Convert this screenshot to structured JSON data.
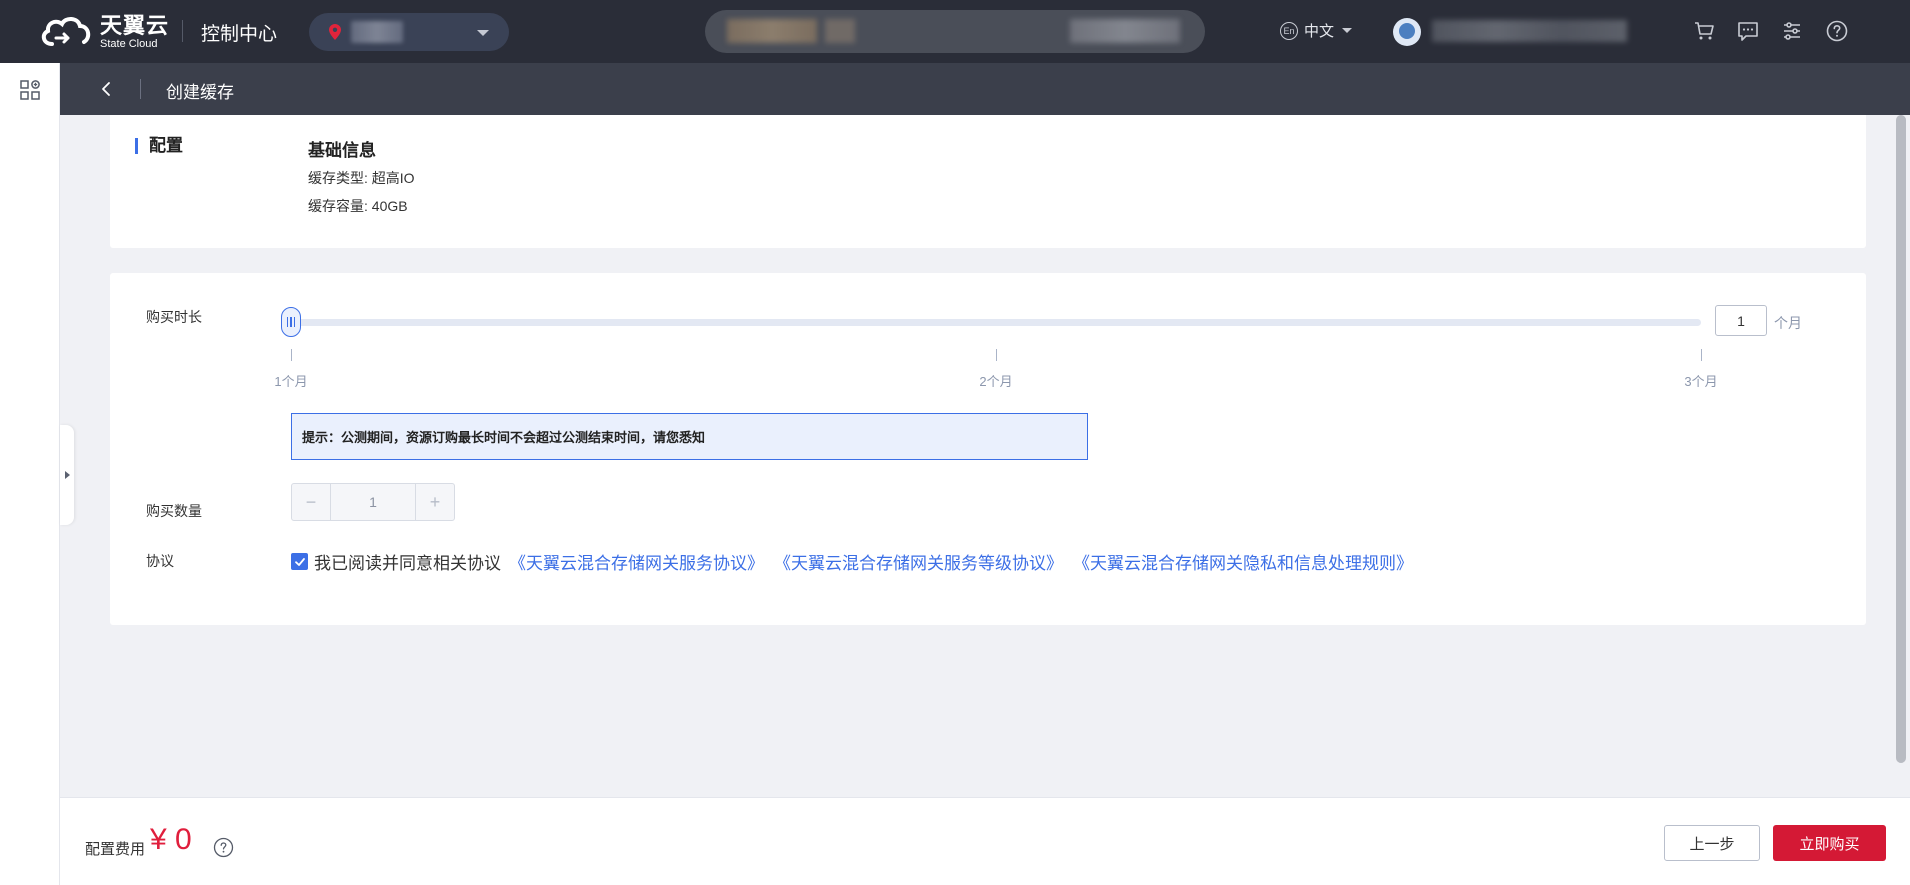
{
  "header": {
    "logo_cn": "天翼云",
    "logo_en": "State Cloud",
    "console_title": "控制中心",
    "language": "中文",
    "language_icon": "En"
  },
  "subheader": {
    "title": "创建缓存"
  },
  "config": {
    "section_label": "配置",
    "info_title": "基础信息",
    "cache_type": "缓存类型: 超高IO",
    "cache_capacity": "缓存容量: 40GB"
  },
  "purchase": {
    "duration_label": "购买时长",
    "duration_value": "1",
    "duration_unit": "个月",
    "slider": {
      "min": 1,
      "max": 3,
      "value": 1
    },
    "ticks": [
      "1个月",
      "2个月",
      "3个月"
    ],
    "notice": "提示：公测期间，资源订购最长时间不会超过公测结束时间，请您悉知",
    "quantity_label": "购买数量",
    "quantity_value": "1",
    "quantity_minus": "−",
    "quantity_plus": "+",
    "agreement_label": "协议",
    "agreement_text": "我已阅读并同意相关协议",
    "agreement_checked": true,
    "agreement_links": [
      "《天翼云混合存储网关服务协议》",
      "《天翼云混合存储网关服务等级协议》",
      "《天翼云混合存储网关隐私和信息处理规则》"
    ]
  },
  "footer": {
    "fee_label": "配置费用",
    "fee_value": "¥ 0",
    "prev_button": "上一步",
    "buy_button": "立即购买"
  },
  "colors": {
    "accent": "#3c6fe6",
    "danger": "#d41935",
    "topbar": "#2a2d38"
  }
}
